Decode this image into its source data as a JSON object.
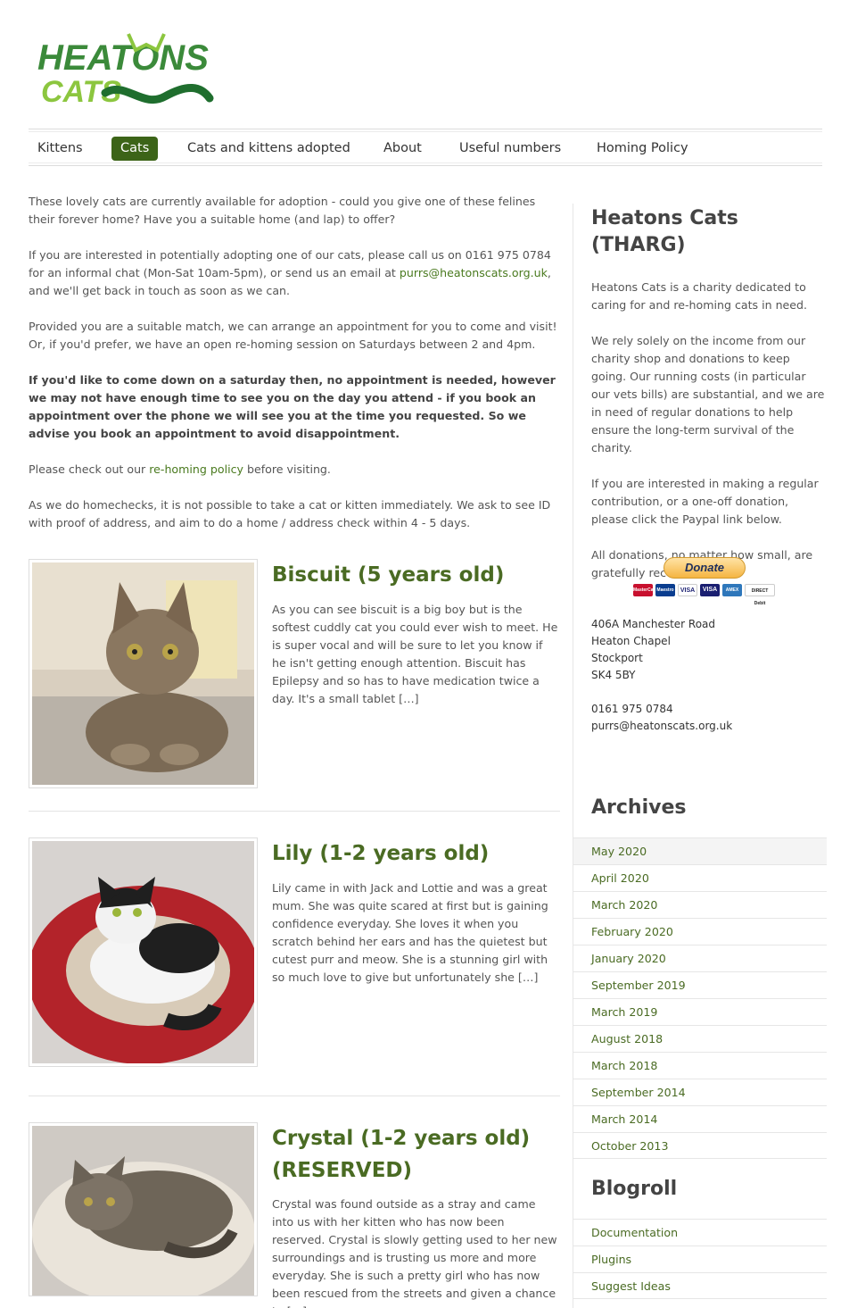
{
  "logo": {
    "line1": "HEATONS",
    "line2": "CATS"
  },
  "nav": {
    "items": [
      {
        "label": "Kittens"
      },
      {
        "label": "Cats"
      },
      {
        "label": "Cats and kittens adopted"
      },
      {
        "label": "About"
      },
      {
        "label": "Useful numbers"
      },
      {
        "label": "Homing Policy"
      }
    ]
  },
  "intro": {
    "p1": "These lovely cats are currently available for adoption - could you give one of these felines their forever home? Have you a suitable home (and lap) to offer?",
    "p2_before": "If you are interested in potentially adopting one of our cats, please call us on 0161 975 0784 for an informal chat (Mon-Sat 10am-5pm), or send us an email at ",
    "p2_link": "purrs@heatonscats.org.uk",
    "p2_after": ", and we'll get back in touch as soon as we can.",
    "p3": "Provided you are a suitable match, we can arrange an appointment for you to come and visit! Or, if you'd prefer, we have an open re-homing session on Saturdays between 2 and 4pm.",
    "p4": "If you'd like to come down on a saturday then, no appointment is needed, however we may not have enough time to see you on the day you attend - if you book an appointment over the phone we will see you at the time you requested. So we advise you book an appointment to avoid disappointment.",
    "p5_before": "Please check out our ",
    "p5_link": "re-homing policy",
    "p5_after": " before visiting.",
    "p6": "As we do homechecks, it is not possible to take a cat or kitten immediately. We ask to see ID with proof of address, and aim to do a home / address check within 4 - 5 days."
  },
  "posts": [
    {
      "title": "Biscuit (5 years old)",
      "excerpt": "As you can see biscuit is a big boy but is the softest cuddly cat you could ever wish to meet. He is super vocal and will be sure to let you know if he isn't getting enough attention. Biscuit has Epilepsy and so has to have medication twice a day. It's a small tablet […]"
    },
    {
      "title": "Lily (1-2 years old)",
      "excerpt": "Lily came in with Jack and Lottie and was a great mum. She was quite scared at first but is gaining confidence everyday. She loves it when you scratch behind her ears and has the quietest but cutest purr and meow. She is a stunning girl with so much love to give but unfortunately she […]"
    },
    {
      "title": "Crystal (1-2 years old) (RESERVED)",
      "excerpt": "Crystal was found outside as a stray and came into us with her kitten who has now been reserved. Crystal is slowly getting used to her new surroundings and is trusting us more and more everyday. She is such a pretty girl who has now been rescued from the streets and given a chance to […]"
    }
  ],
  "sidebar": {
    "about_title": "Heatons Cats (THARG)",
    "about_p1": "Heatons Cats is a charity dedicated to caring for and re-homing cats in need.",
    "about_p2": "We rely solely on the income from our charity shop and donations to keep going. Our running costs (in particular our vets bills) are substantial, and we are in need of regular donations to help ensure the long-term survival of the charity.",
    "about_p3": "If you are interested in making a regular contribution, or a one-off donation, please click the Paypal link below.",
    "about_p4": "All donations, no matter how small, are gratefully received.",
    "donate_label": "Donate",
    "cards": [
      "MasterCard",
      "Maestro",
      "VISA",
      "VISA",
      "AMEX",
      "DIRECT Debit"
    ],
    "address": [
      "406A Manchester Road",
      "Heaton Chapel",
      "Stockport",
      "SK4 5BY"
    ],
    "phone": "0161 975 0784",
    "email": "purrs@heatonscats.org.uk",
    "archives_title": "Archives",
    "archives": [
      "May 2020",
      "April 2020",
      "March 2020",
      "February 2020",
      "January 2020",
      "September 2019",
      "March 2019",
      "August 2018",
      "March 2018",
      "September 2014",
      "March 2014",
      "October 2013"
    ],
    "blogroll_title": "Blogroll",
    "blogroll": [
      "Documentation",
      "Plugins",
      "Suggest Ideas"
    ]
  },
  "colors": {
    "brand_green": "#3c6418",
    "title_green": "#4a6b23",
    "link_green": "#4a7a1f"
  }
}
